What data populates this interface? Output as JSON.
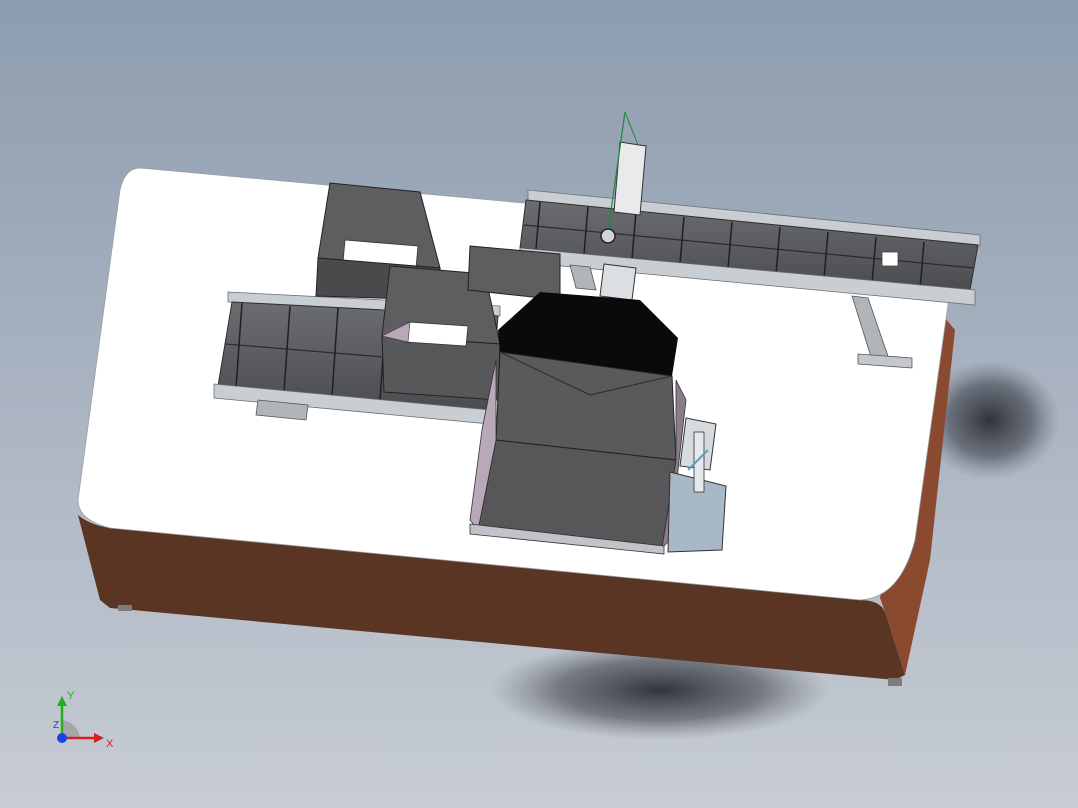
{
  "viewport": {
    "background_top": "#8d9caf",
    "background_bottom": "#c7ccd4"
  },
  "model": {
    "table_top_color": "#ffffff",
    "table_body_color": "#5a3524",
    "table_side_color": "#8a4a30",
    "conveyor_frame_color": "#b9bec4",
    "conveyor_belt_color": "#585a5c",
    "box_color": "#5e5e60",
    "hopper_cover_color": "#0a0a0a"
  },
  "triad": {
    "y_label": "Y",
    "x_label": "X",
    "z_label": "Z",
    "y_color": "#22b022",
    "x_color": "#d42020",
    "z_color": "#2040e0"
  }
}
